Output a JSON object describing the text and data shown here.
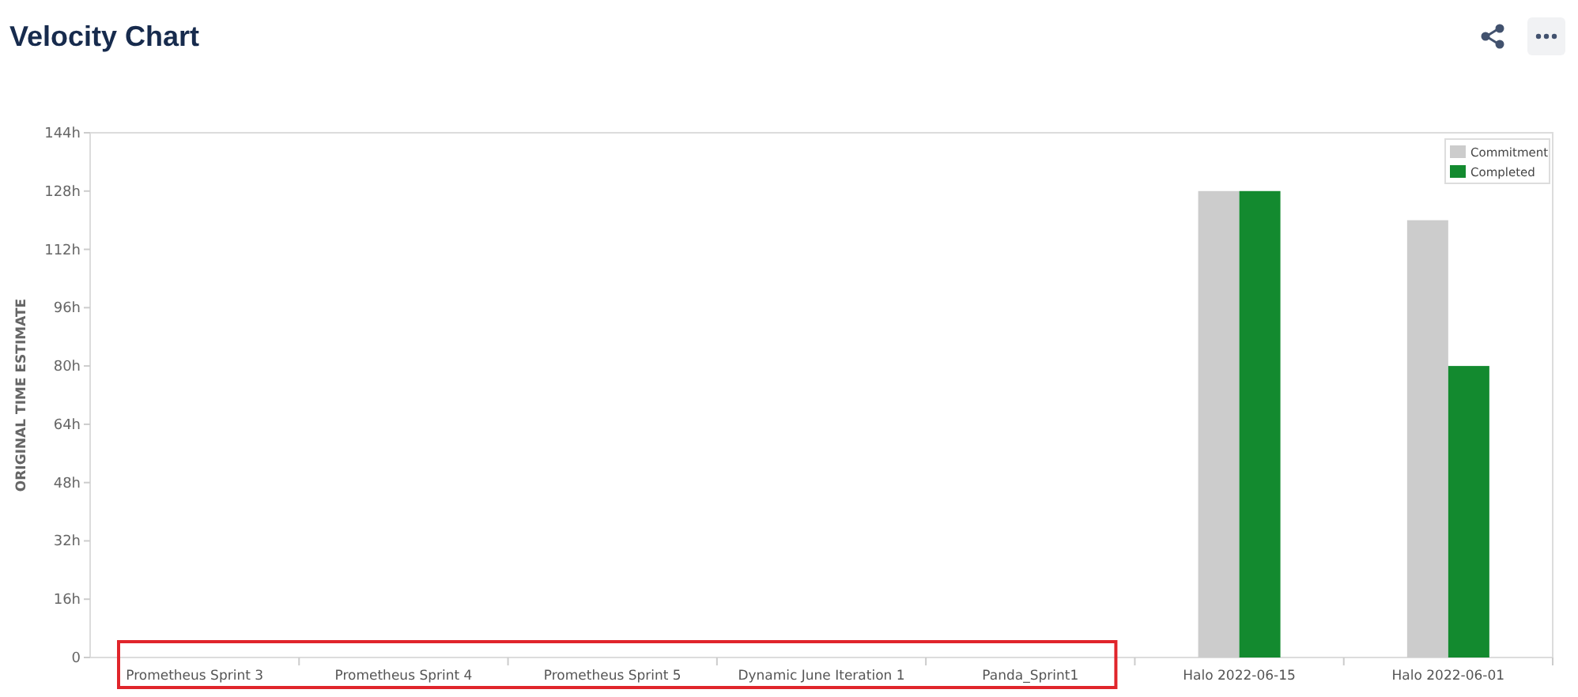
{
  "page": {
    "title": "Velocity Chart"
  },
  "toolbar": [
    {
      "kind": "share"
    },
    {
      "kind": "more"
    }
  ],
  "highlight_box": true,
  "chart_data": {
    "type": "bar",
    "ylabel": "ORIGINAL TIME ESTIMATE",
    "categories": [
      "Prometheus Sprint 3",
      "Prometheus Sprint 4",
      "Prometheus Sprint 5",
      "Dynamic June Iteration 1",
      "Panda_Sprint1",
      "Halo 2022-06-15",
      "Halo 2022-06-01"
    ],
    "series": [
      {
        "name": "Commitment",
        "color": "#cccccc",
        "values": [
          0,
          0,
          0,
          0,
          0,
          128,
          120
        ]
      },
      {
        "name": "Completed",
        "color": "#138a2f",
        "values": [
          0,
          0,
          0,
          0,
          0,
          128,
          80
        ]
      }
    ],
    "ylim": [
      0,
      144
    ],
    "yticks": [
      {
        "value": 0,
        "label": "0"
      },
      {
        "value": 16,
        "label": "16h"
      },
      {
        "value": 32,
        "label": "32h"
      },
      {
        "value": 48,
        "label": "48h"
      },
      {
        "value": 64,
        "label": "64h"
      },
      {
        "value": 80,
        "label": "80h"
      },
      {
        "value": 96,
        "label": "96h"
      },
      {
        "value": 112,
        "label": "112h"
      },
      {
        "value": 128,
        "label": "128h"
      },
      {
        "value": 144,
        "label": "144h"
      }
    ],
    "legend": true
  }
}
